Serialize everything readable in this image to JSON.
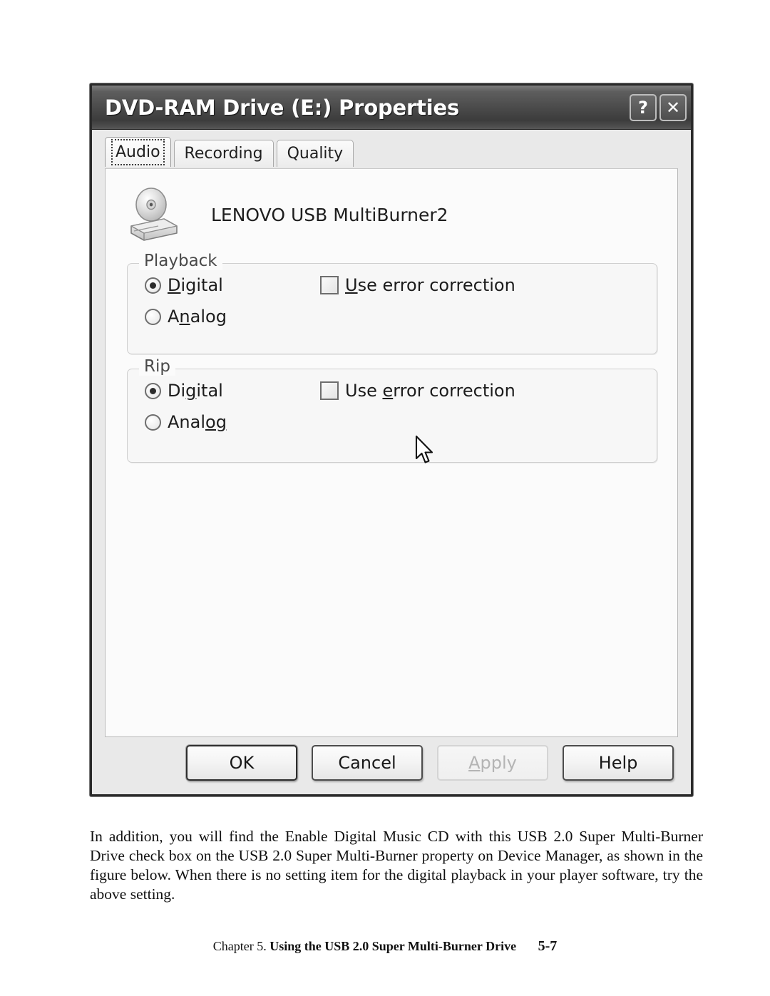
{
  "dialog": {
    "title": "DVD-RAM Drive (E:) Properties",
    "caption_buttons": [
      {
        "name": "help-caption-button",
        "glyph": "?"
      },
      {
        "name": "close-caption-button",
        "glyph": "✕"
      }
    ],
    "tabs": [
      {
        "label": "Audio",
        "active": true
      },
      {
        "label": "Recording",
        "active": false
      },
      {
        "label": "Quality",
        "active": false
      }
    ],
    "device": {
      "name": "LENOVO  USB MultiBurner2",
      "icon": "cd-drive-icon"
    },
    "groups": [
      {
        "title": "Playback",
        "radio_label_digital_pre": "D",
        "radio_label_digital_accel": "",
        "options": [
          {
            "label": "Digital",
            "accel_index": 0,
            "checked": true
          },
          {
            "label": "Analog",
            "accel_index": 1,
            "checked": false
          }
        ],
        "checkbox": {
          "label": "Use error correction",
          "accel_index": 0,
          "checked": false
        }
      },
      {
        "title": "Rip",
        "options": [
          {
            "label": "Digital",
            "accel_index": 2,
            "checked": true
          },
          {
            "label": "Analog",
            "accel_index": 4,
            "checked": false
          }
        ],
        "checkbox": {
          "label": "Use error correction",
          "accel_index": 4,
          "checked": false
        }
      }
    ],
    "buttons": [
      {
        "label": "OK",
        "state": "default"
      },
      {
        "label": "Cancel",
        "state": "normal"
      },
      {
        "label": "Apply",
        "state": "disabled",
        "accel_index": 0
      },
      {
        "label": "Help",
        "state": "normal"
      }
    ]
  },
  "page": {
    "body_text": "In addition, you will find the Enable Digital Music CD with this USB 2.0 Super Multi-Burner Drive check box on the USB 2.0 Super Multi-Burner property on Device Manager, as shown in the figure below. When there is no setting item for the digital playback in your player software, try the above setting.",
    "footer": {
      "chapter": "Chapter 5.",
      "title": "Using the USB 2.0 Super Multi-Burner Drive",
      "page_number": "5-7"
    }
  },
  "colors": {
    "title_bar": "#4a4a4a",
    "dialog_face": "#e9e9e9",
    "panel_face": "#fbfbfb",
    "frame": "#2a2a2a"
  }
}
